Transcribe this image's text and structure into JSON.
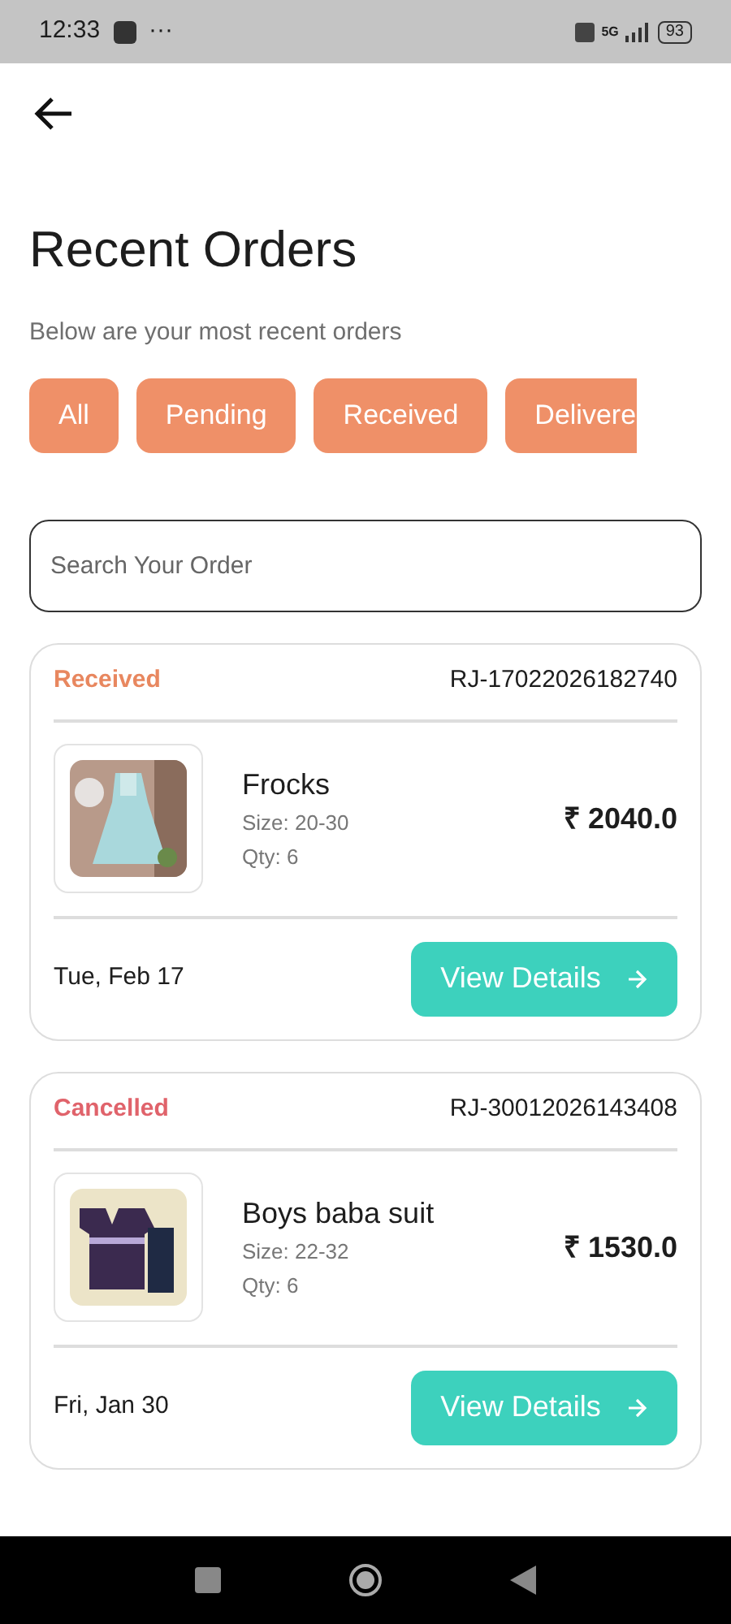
{
  "status_bar": {
    "time": "12:33",
    "dots": "···",
    "network": "5G",
    "battery": "93"
  },
  "title": "Recent Orders",
  "subtitle": "Below are your most recent orders",
  "filters": [
    {
      "label": "All"
    },
    {
      "label": "Pending"
    },
    {
      "label": "Received"
    },
    {
      "label": "Delivere",
      "cut": true
    }
  ],
  "search": {
    "placeholder": "Search Your Order"
  },
  "orders": [
    {
      "status": "Received",
      "color": "#e8875f",
      "order_id": "RJ-17022026182740",
      "product": "Frocks",
      "size": "Size: 20-30",
      "qty": "Qty: 6",
      "price": "₹ 2040.0",
      "date": "Tue, Feb 17",
      "button": "View Details",
      "kind": "picture"
    },
    {
      "status": "Cancelled",
      "color": "#e0636b",
      "order_id": "RJ-30012026143408",
      "product": "Boys baba suit",
      "size": "Size: 22-32",
      "qty": "Qty: 6",
      "price": "₹ 1530.0",
      "date": "Fri, Jan 30",
      "button": "View Details",
      "kind": "picture"
    }
  ]
}
